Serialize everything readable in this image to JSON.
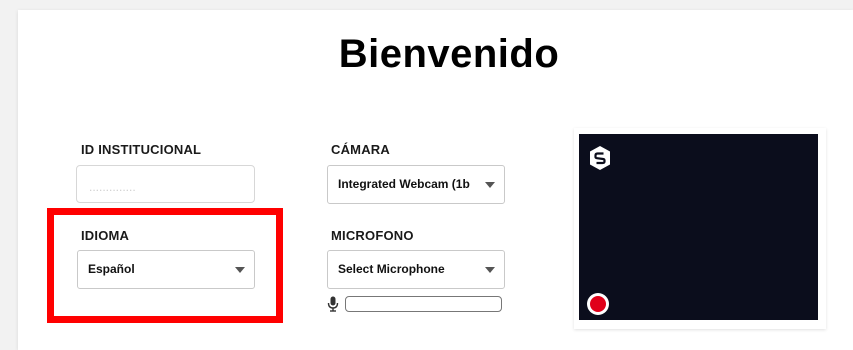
{
  "page": {
    "title": "Bienvenido"
  },
  "form": {
    "id_label": "ID INSTITUCIONAL",
    "id_value": "",
    "id_placeholder": "..............",
    "language_label": "IDIOMA",
    "language_value": "Español",
    "camera_label": "CÁMARA",
    "camera_value": "Integrated Webcam (1b",
    "microphone_label": "MICROFONO",
    "microphone_value": "Select Microphone"
  },
  "icons": {
    "microphone": "microphone-icon",
    "logo": "hexagon-logo-icon",
    "record": "record-icon",
    "dropdown": "chevron-down-icon"
  },
  "colors": {
    "highlight": "#ff0000",
    "preview_bg": "#0b0d1c",
    "record": "#e0001a"
  },
  "mic_level": 0
}
